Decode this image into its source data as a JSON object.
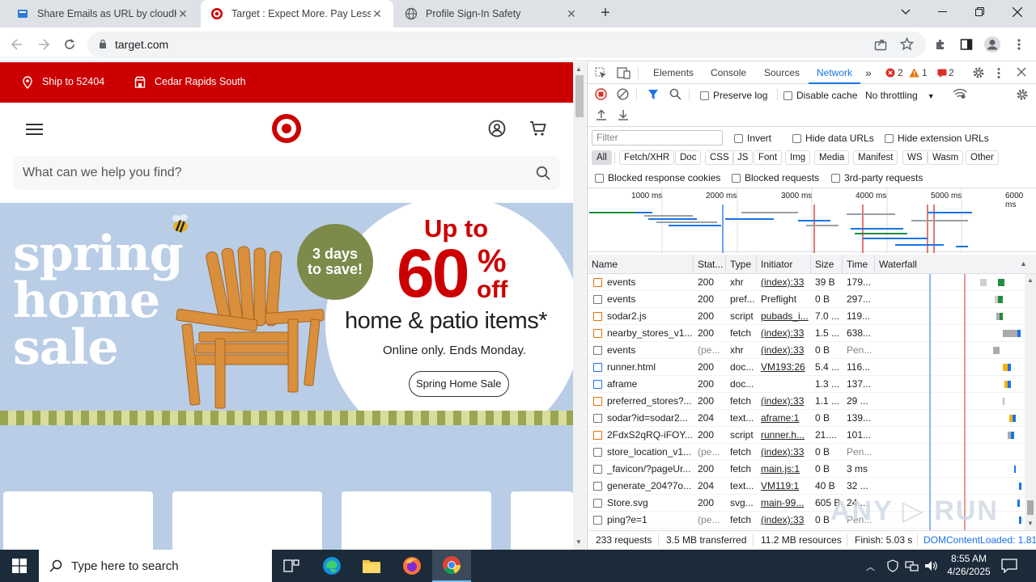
{
  "tabs": [
    {
      "title": "Share Emails as URL by cloudHQ"
    },
    {
      "title": "Target : Expect More. Pay Less."
    },
    {
      "title": "Profile Sign-In Safety"
    }
  ],
  "address": {
    "url": "target.com"
  },
  "target": {
    "ship_to": "Ship to 52404",
    "store": "Cedar Rapids South",
    "search_placeholder": "What can we help you find?",
    "hero": {
      "title_lines": [
        "spring",
        "home",
        "sale"
      ],
      "badge_line1": "3 days",
      "badge_line2": "to save!",
      "up_to": "Up to",
      "percent": "60",
      "percent_sign": "%",
      "off": "off",
      "subtitle": "home & patio items*",
      "note": "Online only. Ends Monday.",
      "cta": "Spring Home Sale"
    }
  },
  "devtools": {
    "tabs": [
      "Elements",
      "Console",
      "Sources",
      "Network"
    ],
    "active_tab": "Network",
    "errors": "2",
    "warnings": "1",
    "issues": "2",
    "preserve_log": "Preserve log",
    "disable_cache": "Disable cache",
    "throttling": "No throttling",
    "filter_placeholder": "Filter",
    "invert": "Invert",
    "hide_data_urls": "Hide data URLs",
    "hide_extension_urls": "Hide extension URLs",
    "type_filters": [
      "All",
      "Fetch/XHR",
      "Doc",
      "CSS",
      "JS",
      "Font",
      "Img",
      "Media",
      "Manifest",
      "WS",
      "Wasm",
      "Other"
    ],
    "blocked_response_cookies": "Blocked response cookies",
    "blocked_requests": "Blocked requests",
    "third_party": "3rd-party requests",
    "timeline_ticks": [
      "1000 ms",
      "2000 ms",
      "3000 ms",
      "4000 ms",
      "5000 ms",
      "6000 ms"
    ],
    "columns": [
      "Name",
      "Stat...",
      "Type",
      "Initiator",
      "Size",
      "Time",
      "Waterfall"
    ],
    "rows": [
      {
        "name": "events",
        "status": "200",
        "type": "xhr",
        "initiator": "(index):33",
        "size": "39 B",
        "time": "179...",
        "icon": "xhr"
      },
      {
        "name": "events",
        "status": "200",
        "type": "pref...",
        "initiator": "Preflight",
        "size": "0 B",
        "time": "297...",
        "icon": "doc"
      },
      {
        "name": "sodar2.js",
        "status": "200",
        "type": "script",
        "initiator": "pubads_i...",
        "size": "7.0 ...",
        "time": "119...",
        "icon": "script"
      },
      {
        "name": "nearby_stores_v1...",
        "status": "200",
        "type": "fetch",
        "initiator": "(index):33",
        "size": "1.5 ...",
        "time": "638...",
        "icon": "xhr"
      },
      {
        "name": "events",
        "status": "(pe...",
        "type": "xhr",
        "initiator": "(index):33",
        "size": "0 B",
        "time": "Pen...",
        "icon": "doc"
      },
      {
        "name": "runner.html",
        "status": "200",
        "type": "doc...",
        "initiator": "VM193:26",
        "size": "5.4 ...",
        "time": "116...",
        "icon": "html"
      },
      {
        "name": "aframe",
        "status": "200",
        "type": "doc...",
        "initiator": "",
        "size": "1.3 ...",
        "time": "137...",
        "icon": "html"
      },
      {
        "name": "preferred_stores?...",
        "status": "200",
        "type": "fetch",
        "initiator": "(index):33",
        "size": "1.1 ...",
        "time": "29 ...",
        "icon": "xhr"
      },
      {
        "name": "sodar?id=sodar2...",
        "status": "204",
        "type": "text...",
        "initiator": "aframe:1",
        "size": "0 B",
        "time": "139...",
        "icon": "img"
      },
      {
        "name": "2FdxS2qRQ-iFOY...",
        "status": "200",
        "type": "script",
        "initiator": "runner.h...",
        "size": "21....",
        "time": "101...",
        "icon": "script"
      },
      {
        "name": "store_location_v1...",
        "status": "(pe...",
        "type": "fetch",
        "initiator": "(index):33",
        "size": "0 B",
        "time": "Pen...",
        "icon": "doc"
      },
      {
        "name": "_favicon/?pageUr...",
        "status": "200",
        "type": "fetch",
        "initiator": "main.js:1",
        "size": "0 B",
        "time": "3 ms",
        "icon": "img"
      },
      {
        "name": "generate_204?7o...",
        "status": "204",
        "type": "text...",
        "initiator": "VM119:1",
        "size": "40 B",
        "time": "32 ...",
        "icon": "img"
      },
      {
        "name": "Store.svg",
        "status": "200",
        "type": "svg...",
        "initiator": "main-99...",
        "size": "605 B",
        "time": "24 ...",
        "icon": "img"
      },
      {
        "name": "ping?e=1",
        "status": "(pe...",
        "type": "fetch",
        "initiator": "(index):33",
        "size": "0 B",
        "time": "Pen...",
        "icon": "doc"
      }
    ],
    "status_bar": {
      "requests": "233 requests",
      "transferred": "3.5 MB transferred",
      "resources": "11.2 MB resources",
      "finish": "Finish: 5.03 s",
      "dcl": "DOMContentLoaded: 1.81"
    }
  },
  "taskbar": {
    "search_placeholder": "Type here to search",
    "time": "8:55 AM",
    "date": "4/26/2025"
  },
  "colors": {
    "target_red": "#cc0000",
    "devtools_blue": "#1a73e8",
    "error_red": "#d93025",
    "warning_orange": "#e37400"
  }
}
